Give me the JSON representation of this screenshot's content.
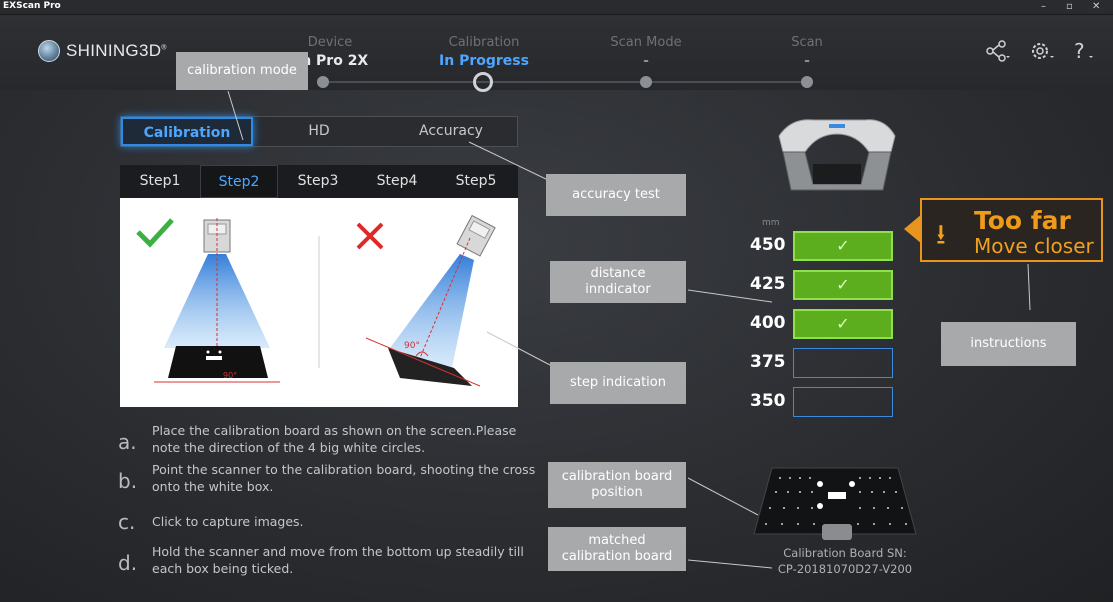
{
  "app": {
    "title": "EXScan Pro"
  },
  "window_controls": {
    "minimize": "–",
    "maximize": "▫",
    "close": "✕"
  },
  "logo": {
    "text": "SHINING3D",
    "reg": "®"
  },
  "stages": [
    {
      "label": "Device",
      "value": "an Pro 2X"
    },
    {
      "label": "Calibration",
      "value": "In Progress"
    },
    {
      "label": "Scan Mode",
      "value": "-"
    },
    {
      "label": "Scan",
      "value": "-"
    }
  ],
  "header_icons": {
    "share": "share-icon",
    "settings": "gear-icon",
    "help": "help-icon"
  },
  "mode_tabs": [
    "Calibration",
    "HD",
    "Accuracy"
  ],
  "step_tabs": [
    "Step1",
    "Step2",
    "Step3",
    "Step4",
    "Step5"
  ],
  "illustration": {
    "angle_label": "90°",
    "angle_label_left": "90°"
  },
  "instructions": [
    {
      "letter": "a.",
      "text": "Place the calibration board as shown on the screen.Please note the direction of the 4 big white circles."
    },
    {
      "letter": "b.",
      "text": "Point the scanner to the calibration board, shooting the cross onto the white box."
    },
    {
      "letter": "c.",
      "text": "Click to capture images."
    },
    {
      "letter": "d.",
      "text": "Hold the scanner and move from the bottom up steadily till each box being ticked."
    }
  ],
  "distance": {
    "unit": "mm",
    "rows": [
      {
        "value": "450",
        "ok": true
      },
      {
        "value": "425",
        "ok": true
      },
      {
        "value": "400",
        "ok": true
      },
      {
        "value": "375",
        "ok": false
      },
      {
        "value": "350",
        "ok": false
      }
    ],
    "tick": "✓"
  },
  "warning": {
    "title": "Too far",
    "subtitle": "Move closer",
    "icon": "download-arrow-icon"
  },
  "board": {
    "sn_label": "Calibration Board SN:",
    "sn_value": "CP-20181070D27-V200"
  },
  "callouts": {
    "calibration_mode": "calibration mode",
    "accuracy_test": "accuracy test",
    "distance_indicator": "distance inndicator",
    "step_indication": "step indication",
    "instructions": "instructions",
    "board_position": "calibration board position",
    "matched_board": "matched calibration board"
  },
  "colors": {
    "accent": "#4ea6ff",
    "ok_green": "#5cae1f",
    "warning": "#f09a1a",
    "callout_bg": "#a8a9ab"
  }
}
